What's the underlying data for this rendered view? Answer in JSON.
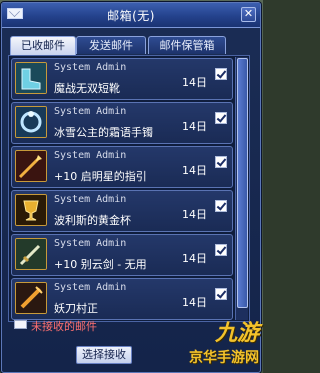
{
  "window": {
    "title": "邮箱(无)"
  },
  "tabs": [
    {
      "label": "已收邮件",
      "active": true
    },
    {
      "label": "发送邮件",
      "active": false
    },
    {
      "label": "邮件保管箱",
      "active": false
    }
  ],
  "mails": [
    {
      "sender": "System Admin",
      "subject": "魔战无双短靴",
      "date": "14日",
      "icon": "boots-icon",
      "checked": true
    },
    {
      "sender": "System Admin",
      "subject": "冰雪公主的霜语手镯",
      "date": "14日",
      "icon": "bracelet-icon",
      "checked": true
    },
    {
      "sender": "System Admin",
      "subject": "+10 启明星的指引",
      "date": "14日",
      "icon": "star-weapon-icon",
      "checked": true
    },
    {
      "sender": "System Admin",
      "subject": "波利斯的黄金杯",
      "date": "14日",
      "icon": "golden-cup-icon",
      "checked": true
    },
    {
      "sender": "System Admin",
      "subject": "+10 别云剑 - 无用",
      "date": "14日",
      "icon": "sword-icon",
      "checked": true
    },
    {
      "sender": "System Admin",
      "subject": "妖刀村正",
      "date": "14日",
      "icon": "blade-icon",
      "checked": true
    }
  ],
  "footer": {
    "unread_label": "未接收的邮件",
    "select_receive": "选择接收"
  },
  "watermark": {
    "top": "九游",
    "bottom": "京华手游网"
  },
  "colors": {
    "accent": "#24428c",
    "unread": "#ff7070",
    "watermark": "#f3c22b"
  }
}
